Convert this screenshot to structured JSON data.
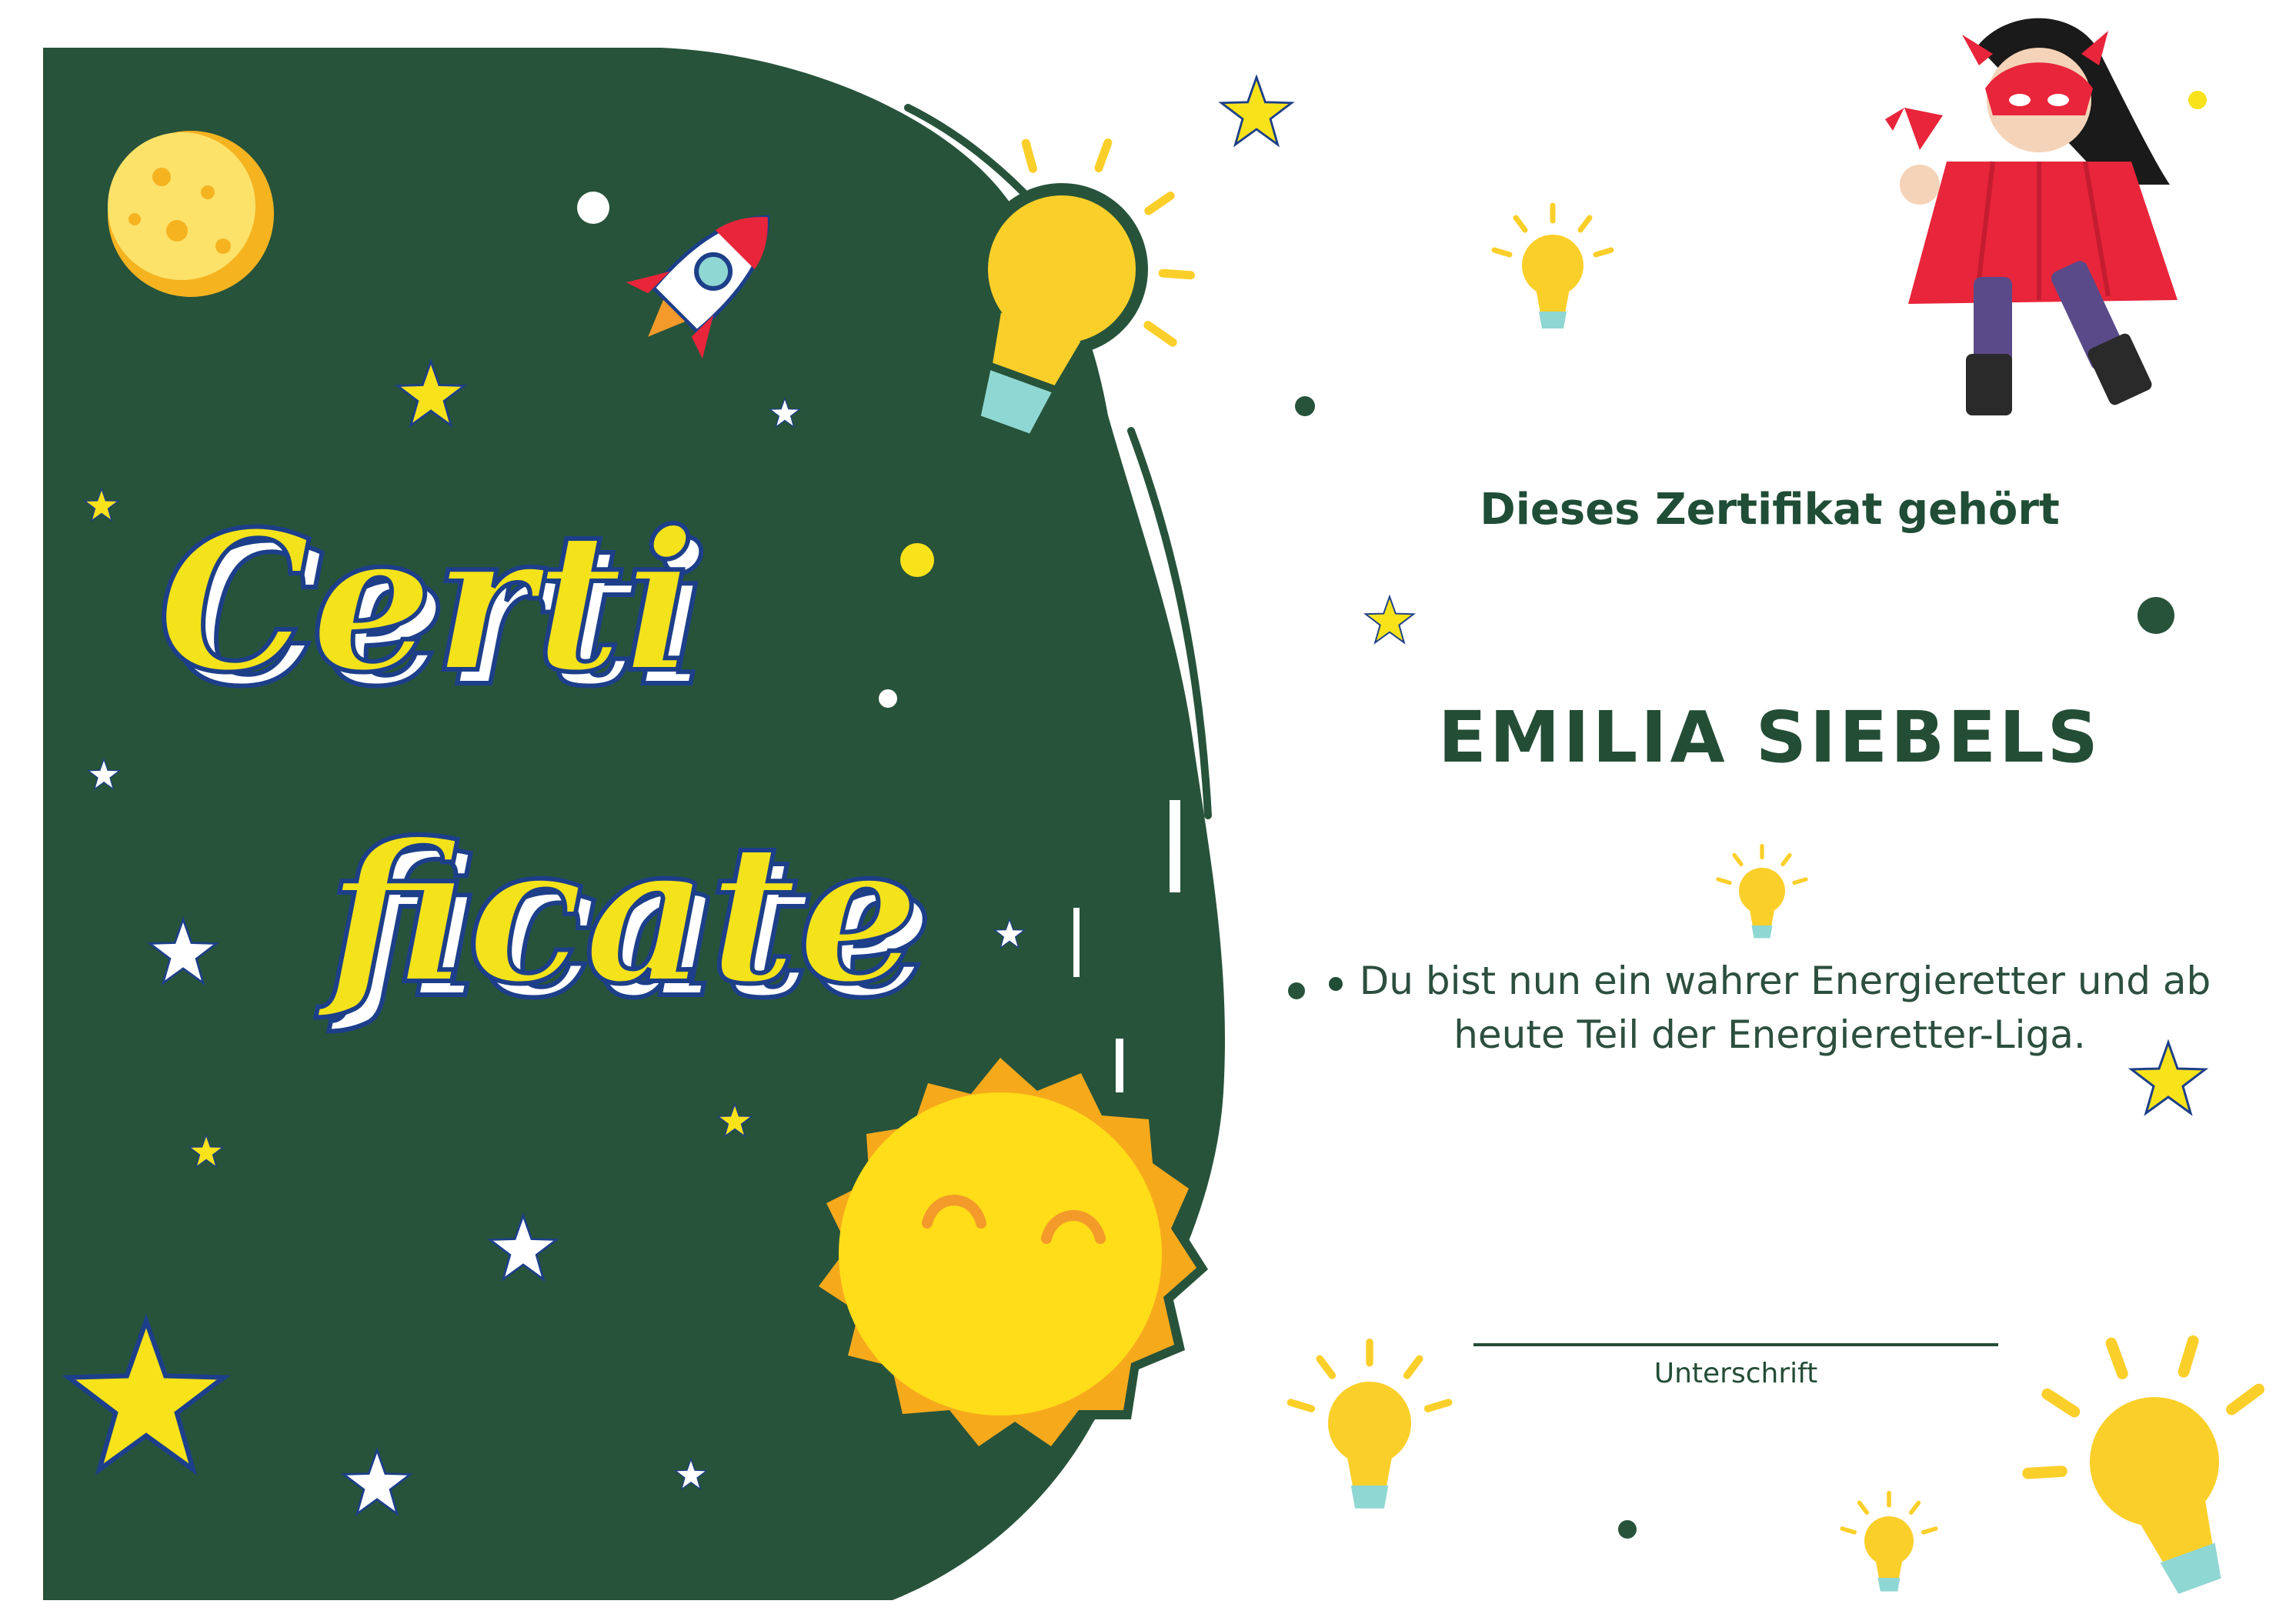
{
  "certificate": {
    "title_line1": "Certi",
    "title_line2": "ficate",
    "owner_heading": "Dieses Zertifikat gehört",
    "recipient_name": "EMILIA SIEBELS",
    "message_line1": "Du bist nun ein wahrer Energieretter und ab",
    "message_line2": "heute Teil der Energieretter-Liga.",
    "signature_label": "Unterschrift"
  },
  "colors": {
    "panel_green": "#27533a",
    "title_yellow": "#f4e21a",
    "title_outline": "#1d3f8a",
    "star_yellow": "#f8e21a",
    "bulb_yellow": "#fbcf2a",
    "bulb_base": "#8fd7d3",
    "sun_yellow": "#ffdd18",
    "hero_red": "#e8253a"
  },
  "icons": [
    "moon-icon",
    "rocket-icon",
    "lightbulb-icon",
    "sun-icon",
    "star-icon",
    "superhero-illustration"
  ]
}
